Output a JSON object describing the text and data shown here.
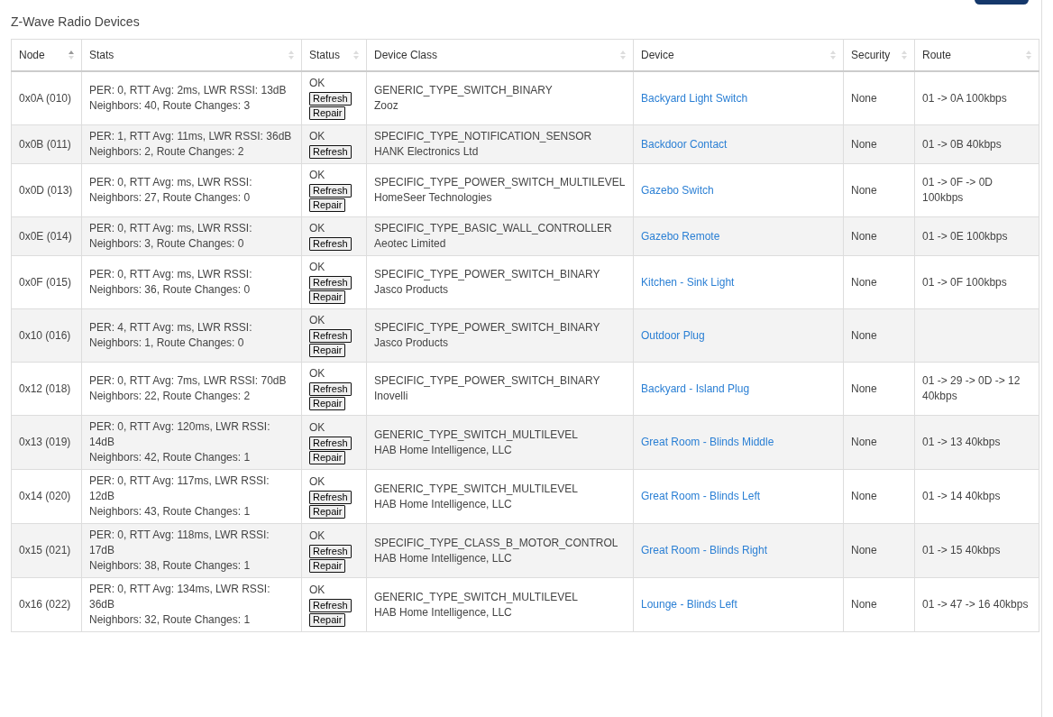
{
  "title": "Z-Wave Radio Devices",
  "columns": [
    {
      "label": "Node",
      "sorted": true
    },
    {
      "label": "Stats",
      "sorted": false
    },
    {
      "label": "Status",
      "sorted": false
    },
    {
      "label": "Device Class",
      "sorted": false
    },
    {
      "label": "Device",
      "sorted": false
    },
    {
      "label": "Security",
      "sorted": false
    },
    {
      "label": "Route",
      "sorted": false
    }
  ],
  "rows": [
    {
      "node": "0x0A (010)",
      "stats": "PER: 0, RTT Avg: 2ms, LWR RSSI: 13dB",
      "neighbors": "Neighbors: 40, Route Changes: 3",
      "status": "OK",
      "buttons": [
        "Refresh",
        "Repair"
      ],
      "device_class": "GENERIC_TYPE_SWITCH_BINARY",
      "manufacturer": "Zooz",
      "device": "Backyard Light Switch",
      "security": "None",
      "route": "01 -> 0A 100kbps"
    },
    {
      "node": "0x0B (011)",
      "stats": "PER: 1, RTT Avg: 11ms, LWR RSSI: 36dB",
      "neighbors": "Neighbors: 2, Route Changes: 2",
      "status": "OK",
      "buttons": [
        "Refresh"
      ],
      "device_class": "SPECIFIC_TYPE_NOTIFICATION_SENSOR",
      "manufacturer": "HANK Electronics Ltd",
      "device": "Backdoor Contact",
      "security": "None",
      "route": "01 -> 0B 40kbps"
    },
    {
      "node": "0x0D (013)",
      "stats": "PER: 0, RTT Avg: ms, LWR RSSI:",
      "neighbors": "Neighbors: 27, Route Changes: 0",
      "status": "OK",
      "buttons": [
        "Refresh",
        "Repair"
      ],
      "device_class": "SPECIFIC_TYPE_POWER_SWITCH_MULTILEVEL",
      "manufacturer": "HomeSeer Technologies",
      "device": "Gazebo Switch",
      "security": "None",
      "route": "01 -> 0F -> 0D 100kbps"
    },
    {
      "node": "0x0E (014)",
      "stats": "PER: 0, RTT Avg: ms, LWR RSSI:",
      "neighbors": "Neighbors: 3, Route Changes: 0",
      "status": "OK",
      "buttons": [
        "Refresh"
      ],
      "device_class": "SPECIFIC_TYPE_BASIC_WALL_CONTROLLER",
      "manufacturer": "Aeotec Limited",
      "device": "Gazebo Remote",
      "security": "None",
      "route": "01 -> 0E 100kbps"
    },
    {
      "node": "0x0F (015)",
      "stats": "PER: 0, RTT Avg: ms, LWR RSSI:",
      "neighbors": "Neighbors: 36, Route Changes: 0",
      "status": "OK",
      "buttons": [
        "Refresh",
        "Repair"
      ],
      "device_class": "SPECIFIC_TYPE_POWER_SWITCH_BINARY",
      "manufacturer": "Jasco Products",
      "device": "Kitchen - Sink Light",
      "security": "None",
      "route": "01 -> 0F 100kbps"
    },
    {
      "node": "0x10 (016)",
      "stats": "PER: 4, RTT Avg: ms, LWR RSSI:",
      "neighbors": "Neighbors: 1, Route Changes: 0",
      "status": "OK",
      "buttons": [
        "Refresh",
        "Repair"
      ],
      "device_class": "SPECIFIC_TYPE_POWER_SWITCH_BINARY",
      "manufacturer": "Jasco Products",
      "device": "Outdoor Plug",
      "security": "None",
      "route": ""
    },
    {
      "node": "0x12 (018)",
      "stats": "PER: 0, RTT Avg: 7ms, LWR RSSI: 70dB",
      "neighbors": "Neighbors: 22, Route Changes: 2",
      "status": "OK",
      "buttons": [
        "Refresh",
        "Repair"
      ],
      "device_class": "SPECIFIC_TYPE_POWER_SWITCH_BINARY",
      "manufacturer": "Inovelli",
      "device": "Backyard - Island Plug",
      "security": "None",
      "route": "01 -> 29 -> 0D -> 12 40kbps"
    },
    {
      "node": "0x13 (019)",
      "stats": "PER: 0, RTT Avg: 120ms, LWR RSSI: 14dB",
      "neighbors": "Neighbors: 42, Route Changes: 1",
      "status": "OK",
      "buttons": [
        "Refresh",
        "Repair"
      ],
      "device_class": "GENERIC_TYPE_SWITCH_MULTILEVEL",
      "manufacturer": "HAB Home Intelligence, LLC",
      "device": "Great Room - Blinds Middle",
      "security": "None",
      "route": "01 -> 13 40kbps"
    },
    {
      "node": "0x14 (020)",
      "stats": "PER: 0, RTT Avg: 117ms, LWR RSSI: 12dB",
      "neighbors": "Neighbors: 43, Route Changes: 1",
      "status": "OK",
      "buttons": [
        "Refresh",
        "Repair"
      ],
      "device_class": "GENERIC_TYPE_SWITCH_MULTILEVEL",
      "manufacturer": "HAB Home Intelligence, LLC",
      "device": "Great Room - Blinds Left",
      "security": "None",
      "route": "01 -> 14 40kbps"
    },
    {
      "node": "0x15 (021)",
      "stats": "PER: 0, RTT Avg: 118ms, LWR RSSI: 17dB",
      "neighbors": "Neighbors: 38, Route Changes: 1",
      "status": "OK",
      "buttons": [
        "Refresh",
        "Repair"
      ],
      "device_class": "SPECIFIC_TYPE_CLASS_B_MOTOR_CONTROL",
      "manufacturer": "HAB Home Intelligence, LLC",
      "device": "Great Room - Blinds Right",
      "security": "None",
      "route": "01 -> 15 40kbps"
    },
    {
      "node": "0x16 (022)",
      "stats": "PER: 0, RTT Avg: 134ms, LWR RSSI: 36dB",
      "neighbors": "Neighbors: 32, Route Changes: 1",
      "status": "OK",
      "buttons": [
        "Refresh",
        "Repair"
      ],
      "device_class": "GENERIC_TYPE_SWITCH_MULTILEVEL",
      "manufacturer": "HAB Home Intelligence, LLC",
      "device": "Lounge - Blinds Left",
      "security": "None",
      "route": "01 -> 47 -> 16 40kbps"
    }
  ]
}
